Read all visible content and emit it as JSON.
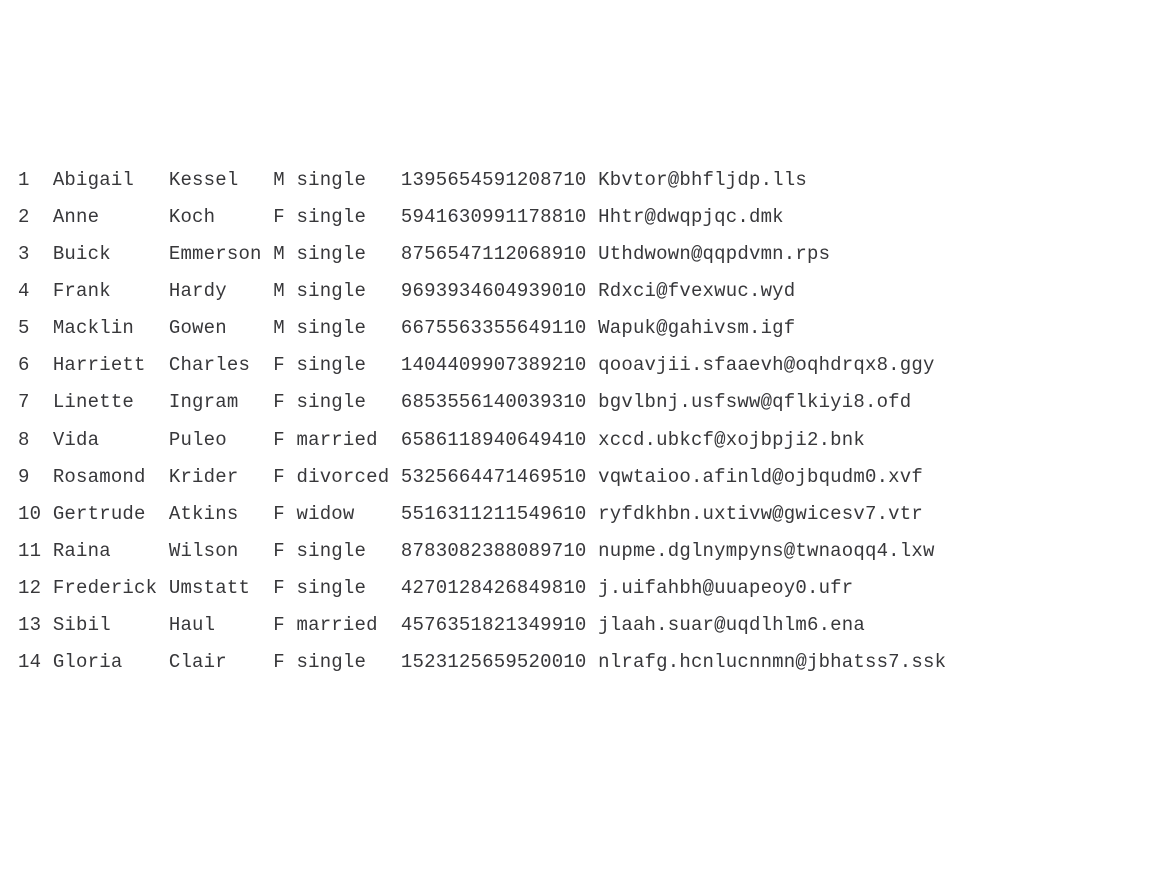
{
  "rows": [
    {
      "idx": "1",
      "first": "Abigail",
      "last": "Kessel",
      "sex": "M",
      "status": "single",
      "number": "1395654591208710",
      "email": "Kbvtor@bhfljdp.lls"
    },
    {
      "idx": "2",
      "first": "Anne",
      "last": "Koch",
      "sex": "F",
      "status": "single",
      "number": "5941630991178810",
      "email": "Hhtr@dwqpjqc.dmk"
    },
    {
      "idx": "3",
      "first": "Buick",
      "last": "Emmerson",
      "sex": "M",
      "status": "single",
      "number": "8756547112068910",
      "email": "Uthdwown@qqpdvmn.rps"
    },
    {
      "idx": "4",
      "first": "Frank",
      "last": "Hardy",
      "sex": "M",
      "status": "single",
      "number": "9693934604939010",
      "email": "Rdxci@fvexwuc.wyd"
    },
    {
      "idx": "5",
      "first": "Macklin",
      "last": "Gowen",
      "sex": "M",
      "status": "single",
      "number": "6675563355649110",
      "email": "Wapuk@gahivsm.igf"
    },
    {
      "idx": "6",
      "first": "Harriett",
      "last": "Charles",
      "sex": "F",
      "status": "single",
      "number": "1404409907389210",
      "email": "qooavjii.sfaaevh@oqhdrqx8.ggy"
    },
    {
      "idx": "7",
      "first": "Linette",
      "last": "Ingram",
      "sex": "F",
      "status": "single",
      "number": "6853556140039310",
      "email": "bgvlbnj.usfsww@qflkiyi8.ofd"
    },
    {
      "idx": "8",
      "first": "Vida",
      "last": "Puleo",
      "sex": "F",
      "status": "married",
      "number": "6586118940649410",
      "email": "xccd.ubkcf@xojbpji2.bnk"
    },
    {
      "idx": "9",
      "first": "Rosamond",
      "last": "Krider",
      "sex": "F",
      "status": "divorced",
      "number": "5325664471469510",
      "email": "vqwtaioo.afinld@ojbqudm0.xvf"
    },
    {
      "idx": "10",
      "first": "Gertrude",
      "last": "Atkins",
      "sex": "F",
      "status": "widow",
      "number": "5516311211549610",
      "email": "ryfdkhbn.uxtivw@gwicesv7.vtr"
    },
    {
      "idx": "11",
      "first": "Raina",
      "last": "Wilson",
      "sex": "F",
      "status": "single",
      "number": "8783082388089710",
      "email": "nupme.dglnympyns@twnaoqq4.lxw"
    },
    {
      "idx": "12",
      "first": "Frederick",
      "last": "Umstatt",
      "sex": "F",
      "status": "single",
      "number": "4270128426849810",
      "email": "j.uifahbh@uuapeoy0.ufr"
    },
    {
      "idx": "13",
      "first": "Sibil",
      "last": "Haul",
      "sex": "F",
      "status": "married",
      "number": "4576351821349910",
      "email": "jlaah.suar@uqdlhlm6.ena"
    },
    {
      "idx": "14",
      "first": "Gloria",
      "last": "Clair",
      "sex": "F",
      "status": "single",
      "number": "1523125659520010",
      "email": "nlrafg.hcnlucnnmn@jbhatss7.ssk"
    }
  ],
  "widths": {
    "idx": 3,
    "first": 10,
    "last": 9,
    "sex": 2,
    "status": 9,
    "number": 17
  }
}
